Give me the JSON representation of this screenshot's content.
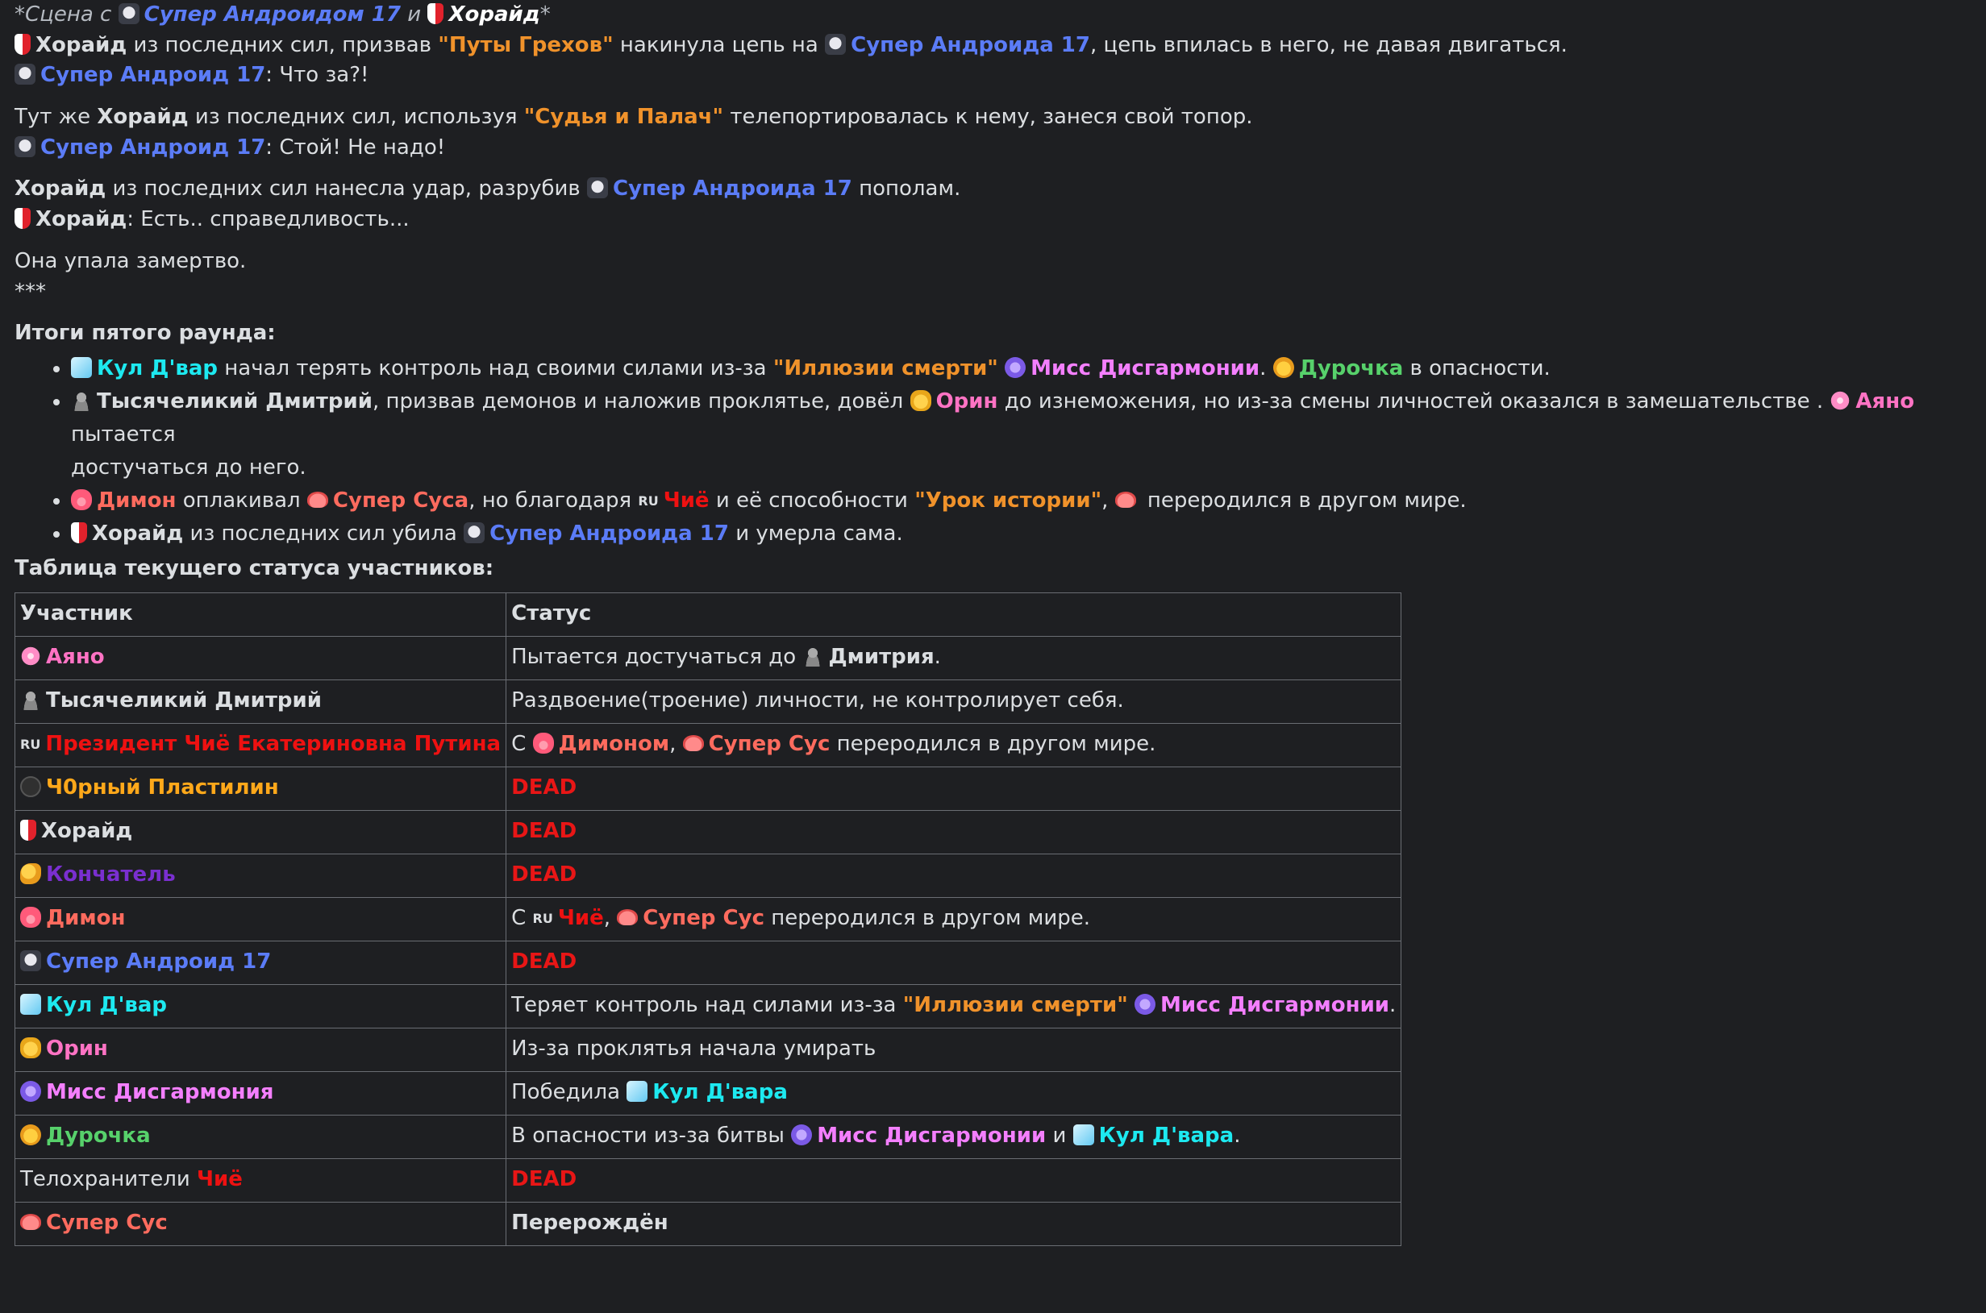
{
  "story": {
    "scene_prefix": "*Сцена с",
    "scene_and": "и",
    "android_nom": "Супер Андроидом 17",
    "horaid": "Хорайд",
    "scene_suffix": "*",
    "line1_a": "из последних сил, призвав",
    "line1_skill": "\"Путы Грехов\"",
    "line1_b": "накинула цепь на",
    "android_gen": "Супер Андроида 17",
    "line1_c": ", цепь впилась в него, не давая двигаться.",
    "android": "Супер Андроид 17",
    "line2_text": ": Что за?!",
    "line3_a": "Тут же",
    "line3_b": "из последних сил, используя",
    "line3_skill": "\"Судья и Палач\"",
    "line3_c": "телепортировалась к нему, занеся свой топор.",
    "line4_text": ": Стой! Не надо!",
    "line5_a": "из последних сил нанесла удар, разрубив",
    "line5_b": "пополам.",
    "line6_text": ": Есть.. справедливость...",
    "line7": "Она упала замертво.",
    "line8": "***"
  },
  "results": {
    "heading": "Итоги пятого раунда:",
    "r1": {
      "name": "Кул Д'вар",
      "a": "начал терять контроль над своими силами из-за",
      "skill": "\"Иллюзии смерти\"",
      "miss": "Мисс Дисгармонии",
      "dot": ".",
      "kid": "Дурочка",
      "b": "в опасности."
    },
    "r2": {
      "name": "Тысячеликий Дмитрий",
      "a": ", призвав демонов и наложив проклятье, довёл",
      "orin": "Орин",
      "b": "до изнеможения, но из-за смены личностей оказался в замешательстве .",
      "ayano": "Аяно",
      "c": "пытается",
      "d": "достучаться до него."
    },
    "r3": {
      "dimon": "Димон",
      "a": "оплакивал",
      "sus": "Супер Суса",
      "b": ", но благодаря",
      "flag": "RU",
      "chie": "Чиё",
      "c": "и её способности",
      "skill": "\"Урок истории\"",
      "comma": ",",
      "d": "переродился в другом мире."
    },
    "r4": {
      "horaid": "Хорайд",
      "a": "из последних сил убила",
      "android": "Супер Андроида 17",
      "b": "и умерла сама."
    },
    "table_heading": "Таблица текущего статуса участников:"
  },
  "table": {
    "col1": "Участник",
    "col2": "Статус",
    "dead": "DEAD",
    "rows": {
      "ayano": {
        "name": "Аяно",
        "s_a": "Пытается достучаться до",
        "s_b": "Дмитрия",
        "s_c": "."
      },
      "dmitry": {
        "name": "Тысячеликий Дмитрий",
        "status": "Раздвоение(троение) личности, не контролирует себя."
      },
      "president": {
        "flag": "RU",
        "name": "Президент Чиё Екатериновна Путина",
        "s_a": "С",
        "s_dimon": "Димоном",
        "s_comma": ",",
        "s_sus": "Супер Сус",
        "s_b": "переродился в другом мире."
      },
      "plasticine": {
        "name": "Ч0рный Пластилин"
      },
      "horaid": {
        "name": "Хорайд"
      },
      "finisher": {
        "name": "Кончатель"
      },
      "dimon": {
        "name": "Димон",
        "s_a": "С",
        "flag": "RU",
        "s_chie": "Чиё",
        "s_comma": ",",
        "s_sus": "Супер Сус",
        "s_b": "переродился в другом мире."
      },
      "android": {
        "name": "Супер Андроид 17"
      },
      "kul": {
        "name": "Кул Д'вар",
        "s_a": "Теряет контроль над силами из-за",
        "s_skill": "\"Иллюзии смерти\"",
        "s_miss": "Мисс Дисгармонии",
        "s_dot": "."
      },
      "orin": {
        "name": "Орин",
        "status": "Из-за проклятья начала умирать"
      },
      "miss": {
        "name": "Мисс Дисгармония",
        "s_a": "Победила",
        "s_kul": "Кул Д'вара"
      },
      "kid": {
        "name": "Дурочка",
        "s_a": "В опасности из-за битвы",
        "s_miss": "Мисс Дисгармонии",
        "s_and": "и",
        "s_kul": "Кул Д'вара",
        "s_dot": "."
      },
      "guards": {
        "name_a": "Телохранители",
        "name_b": "Чиё"
      },
      "sus": {
        "name": "Супер Сус",
        "status": "Перерождён"
      }
    }
  }
}
